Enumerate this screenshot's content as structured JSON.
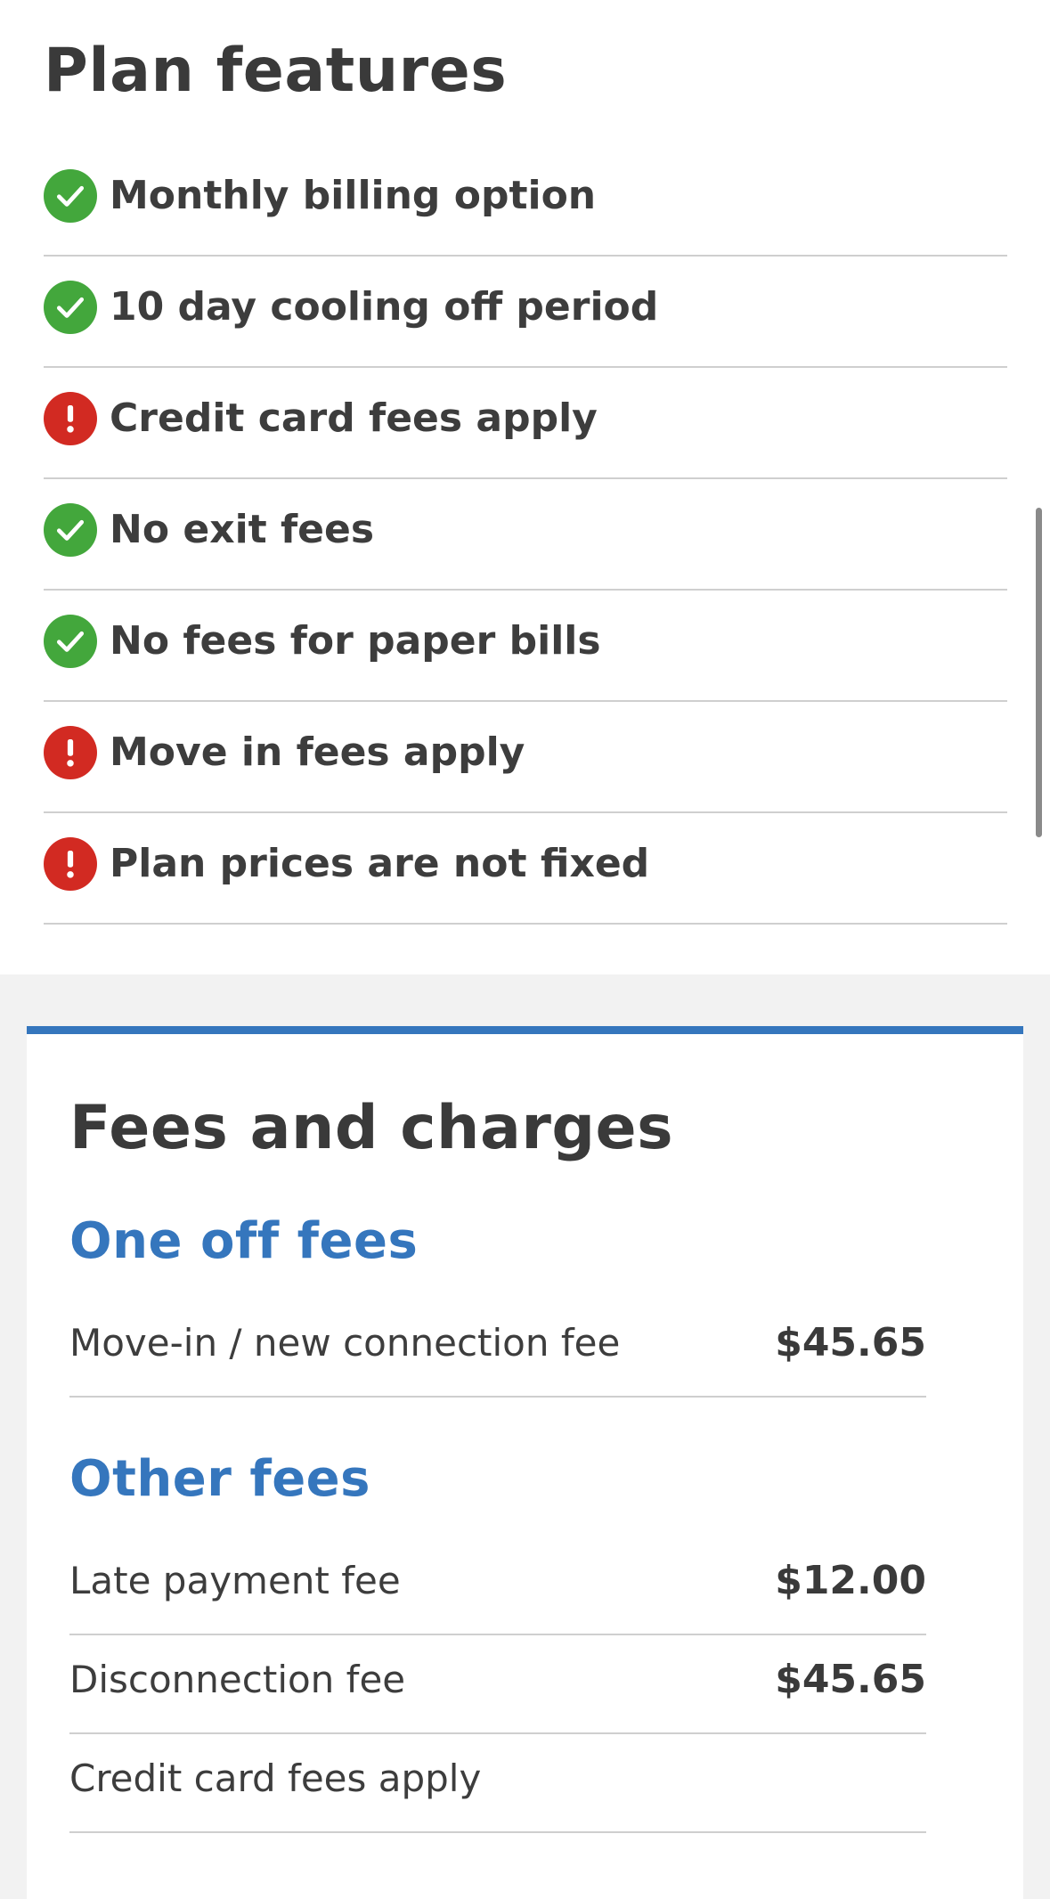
{
  "plan_features": {
    "title": "Plan features",
    "items": [
      {
        "label": "Monthly billing option",
        "status": "check"
      },
      {
        "label": "10 day cooling off period",
        "status": "check"
      },
      {
        "label": "Credit card fees apply",
        "status": "alert"
      },
      {
        "label": "No exit fees",
        "status": "check"
      },
      {
        "label": "No fees for paper bills",
        "status": "check"
      },
      {
        "label": "Move in fees apply",
        "status": "alert"
      },
      {
        "label": "Plan prices are not fixed",
        "status": "alert"
      }
    ]
  },
  "fees_and_charges": {
    "title": "Fees and charges",
    "one_off": {
      "heading": "One off fees",
      "rows": [
        {
          "name": "Move-in / new connection fee",
          "amount": "$45.65"
        }
      ]
    },
    "other": {
      "heading": "Other fees",
      "rows": [
        {
          "name": "Late payment fee",
          "amount": "$12.00"
        },
        {
          "name": "Disconnection fee",
          "amount": "$45.65"
        },
        {
          "name": "Credit card fees apply",
          "amount": ""
        }
      ]
    }
  },
  "colors": {
    "check": "#43a73c",
    "alert": "#d22a22",
    "accent": "#3576bd",
    "divider": "#cfcfcf",
    "text": "#3d3d3d"
  },
  "icons": {
    "check": "check-circle-icon",
    "alert": "exclamation-circle-icon"
  }
}
